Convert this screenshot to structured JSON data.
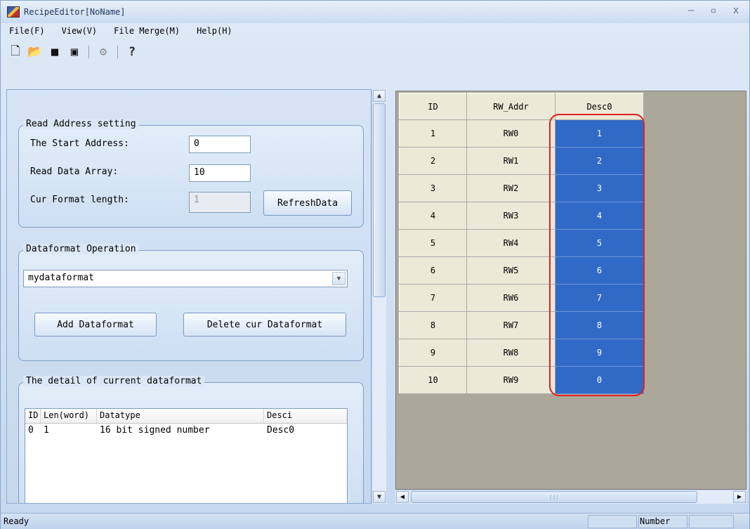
{
  "window": {
    "title": "RecipeEditor[NoName]",
    "controls": [
      "–",
      "▫",
      "x"
    ]
  },
  "menu": [
    "File(F)",
    "View(V)",
    "File Merge(M)",
    "Help(H)"
  ],
  "toolbar_icons": [
    "new-icon",
    "open-icon",
    "save-icon",
    "save-as-icon",
    "settings-icon",
    "help-icon"
  ],
  "read_address": {
    "legend": "Read Address setting",
    "start_label": "The Start Address:",
    "start_value": "0",
    "array_label": "Read Data Array:",
    "array_value": "10",
    "format_label": "Cur Format length:",
    "format_value": "1",
    "refresh": "RefreshData"
  },
  "dataformat": {
    "legend": "Dataformat Operation",
    "selected": "mydataformat",
    "add": "Add Dataformat",
    "delete": "Delete cur Dataformat"
  },
  "detail": {
    "legend": "The detail of current dataformat",
    "columns": [
      "ID",
      "Len(word)",
      "Datatype",
      "Desci"
    ],
    "rows": [
      [
        "0",
        "1",
        "16 bit signed number",
        "Desc0"
      ]
    ]
  },
  "grid": {
    "columns": [
      "ID",
      "RW_Addr",
      "Desc0"
    ],
    "rows": [
      [
        "1",
        "RW0",
        "1"
      ],
      [
        "2",
        "RW1",
        "2"
      ],
      [
        "3",
        "RW2",
        "3"
      ],
      [
        "4",
        "RW3",
        "4"
      ],
      [
        "5",
        "RW4",
        "5"
      ],
      [
        "6",
        "RW5",
        "6"
      ],
      [
        "7",
        "RW6",
        "7"
      ],
      [
        "8",
        "RW7",
        "8"
      ],
      [
        "9",
        "RW8",
        "9"
      ],
      [
        "10",
        "RW9",
        "0"
      ]
    ]
  },
  "status": {
    "left": "Ready",
    "mode": "Number"
  }
}
